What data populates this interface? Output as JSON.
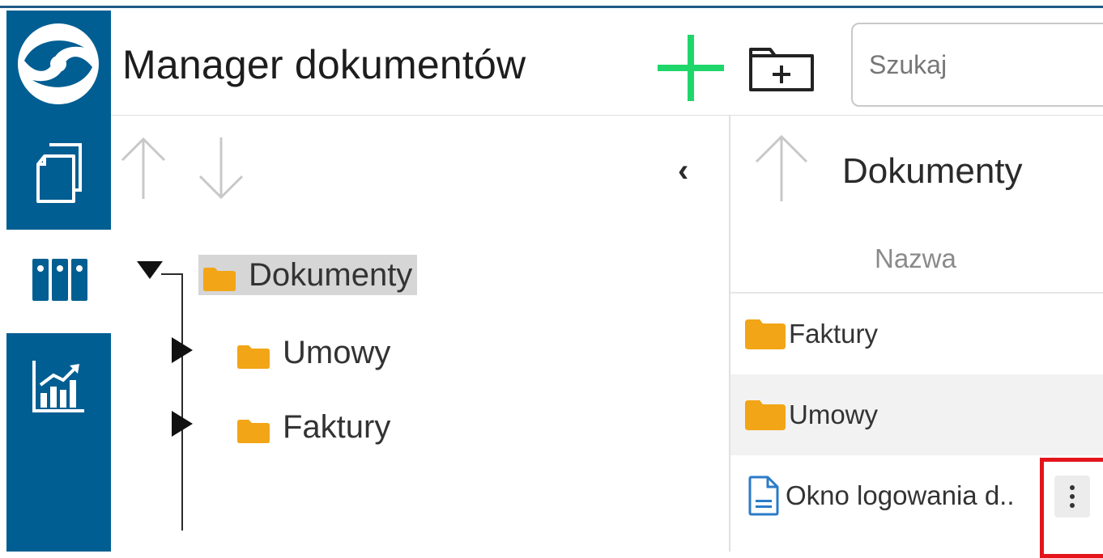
{
  "header": {
    "title": "Manager dokumentów",
    "add_icon": "plus-icon",
    "new_folder_icon": "folder-plus-icon",
    "search_placeholder": "Szukaj"
  },
  "rail": {
    "logo_icon": "app-logo-icon",
    "items": [
      {
        "icon": "documents-icon"
      },
      {
        "icon": "binders-icon"
      },
      {
        "icon": "chart-icon"
      }
    ]
  },
  "tree": {
    "root": {
      "label": "Dokumenty"
    },
    "children": [
      {
        "label": "Umowy"
      },
      {
        "label": "Faktury"
      }
    ]
  },
  "list": {
    "title": "Dokumenty",
    "column_name": "Nazwa",
    "rows": [
      {
        "type": "folder",
        "label": "Faktury"
      },
      {
        "type": "folder",
        "label": "Umowy"
      },
      {
        "type": "file",
        "label": "Okno logowania d.."
      }
    ]
  },
  "colors": {
    "rail": "#005e92",
    "accent_green": "#1fd66a",
    "folder": "#f2a516",
    "highlight": "#e4141b"
  }
}
